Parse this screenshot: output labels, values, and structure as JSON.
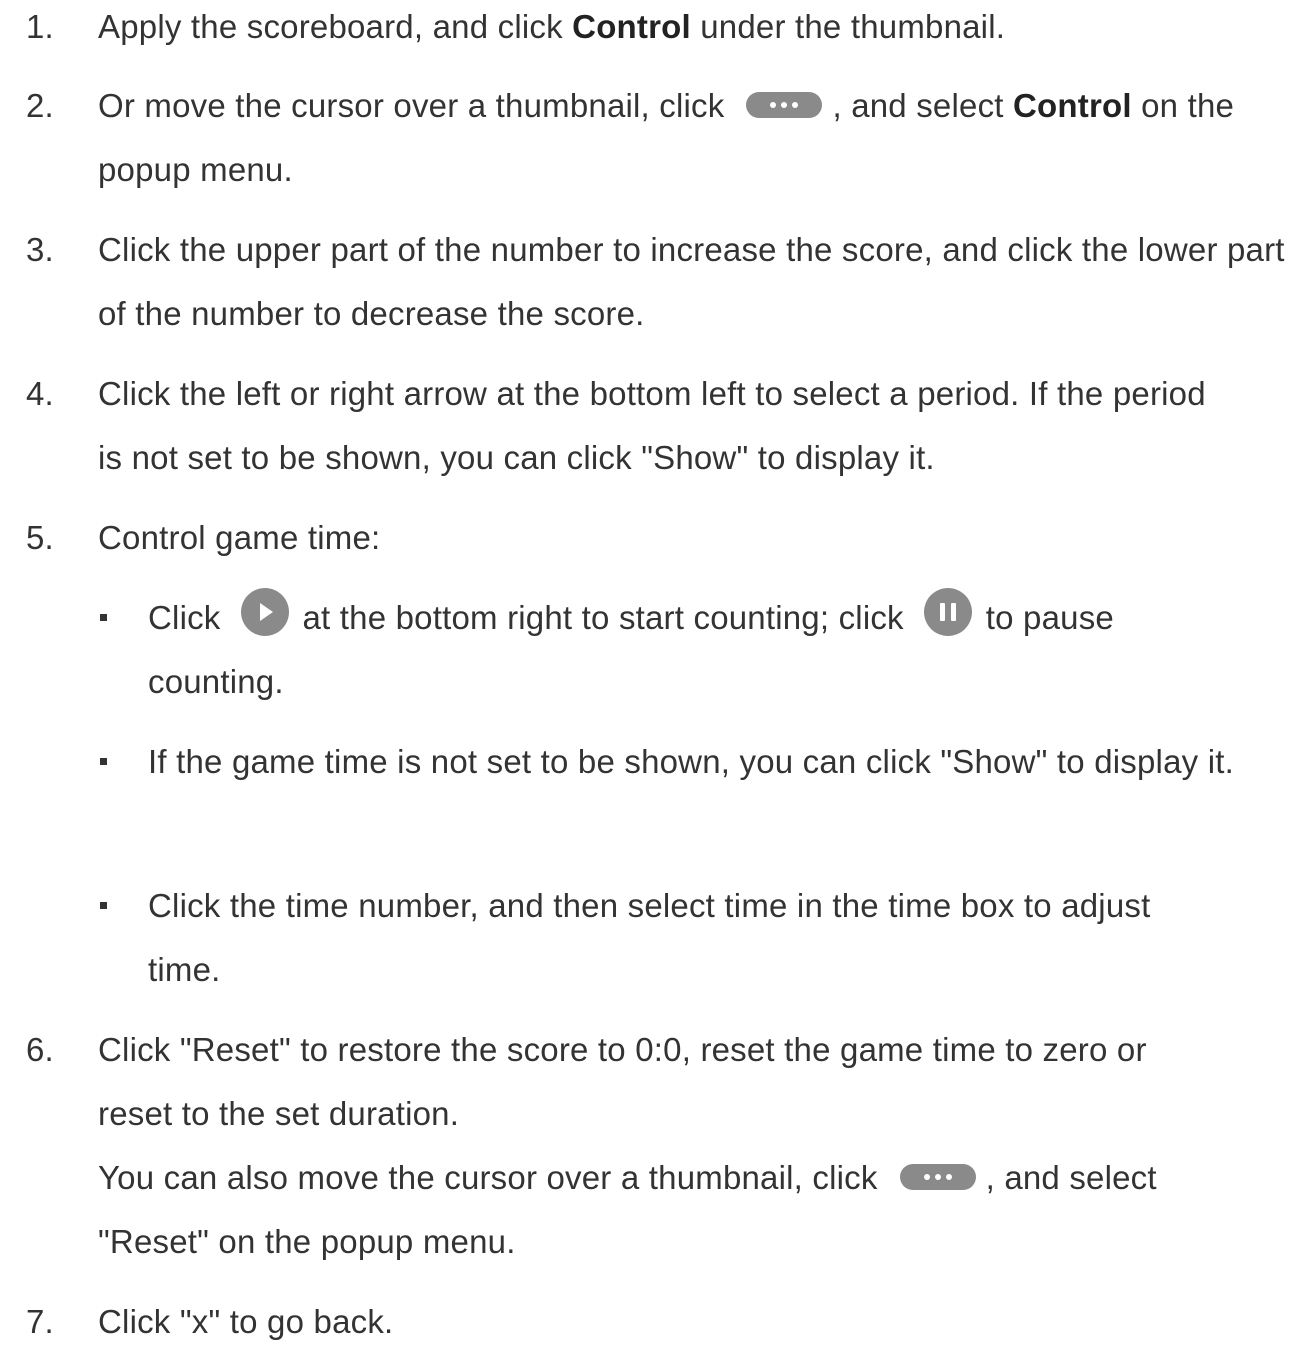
{
  "steps": [
    {
      "number": "1.",
      "text_a": "Apply the scoreboard, and click ",
      "bold": "Control",
      "text_b": " under the thumbnail."
    },
    {
      "number": "2.",
      "text_a": "Or move the cursor over a thumbnail, click",
      "icon": "more-options-icon",
      "text_b": ", and select ",
      "bold": "Control",
      "text_c": " on the popup menu."
    },
    {
      "number": "3.",
      "text": "Click the upper part of the number to increase the score, and click the lower part of the number to decrease the score."
    },
    {
      "number": "4.",
      "text": "Click the left or right arrow at the bottom left to select a period. If the period is not set to be shown, you can click \"Show\" to display it."
    },
    {
      "number": "5.",
      "text": "Control game time:",
      "sub_items": [
        {
          "text_a": "Click",
          "icon_a": "play-icon",
          "text_b": "at the bottom right to start counting; click",
          "icon_b": "pause-icon",
          "text_c": "to pause counting."
        },
        {
          "text": "If the game time is not set to be shown, you can click \"Show\" to display it."
        },
        {
          "text": "Click the time number, and then select time in the time box to adjust time."
        }
      ]
    },
    {
      "number": "6.",
      "text": "Click \"Reset\" to restore the score to 0:0, reset the game time to zero or reset to the set duration.",
      "note_a": "You can also move the cursor over a thumbnail, click",
      "note_icon": "more-options-icon",
      "note_b": ", and select \"Reset\" on the popup menu."
    },
    {
      "number": "7.",
      "text": "Click \"x\" to go back."
    }
  ]
}
